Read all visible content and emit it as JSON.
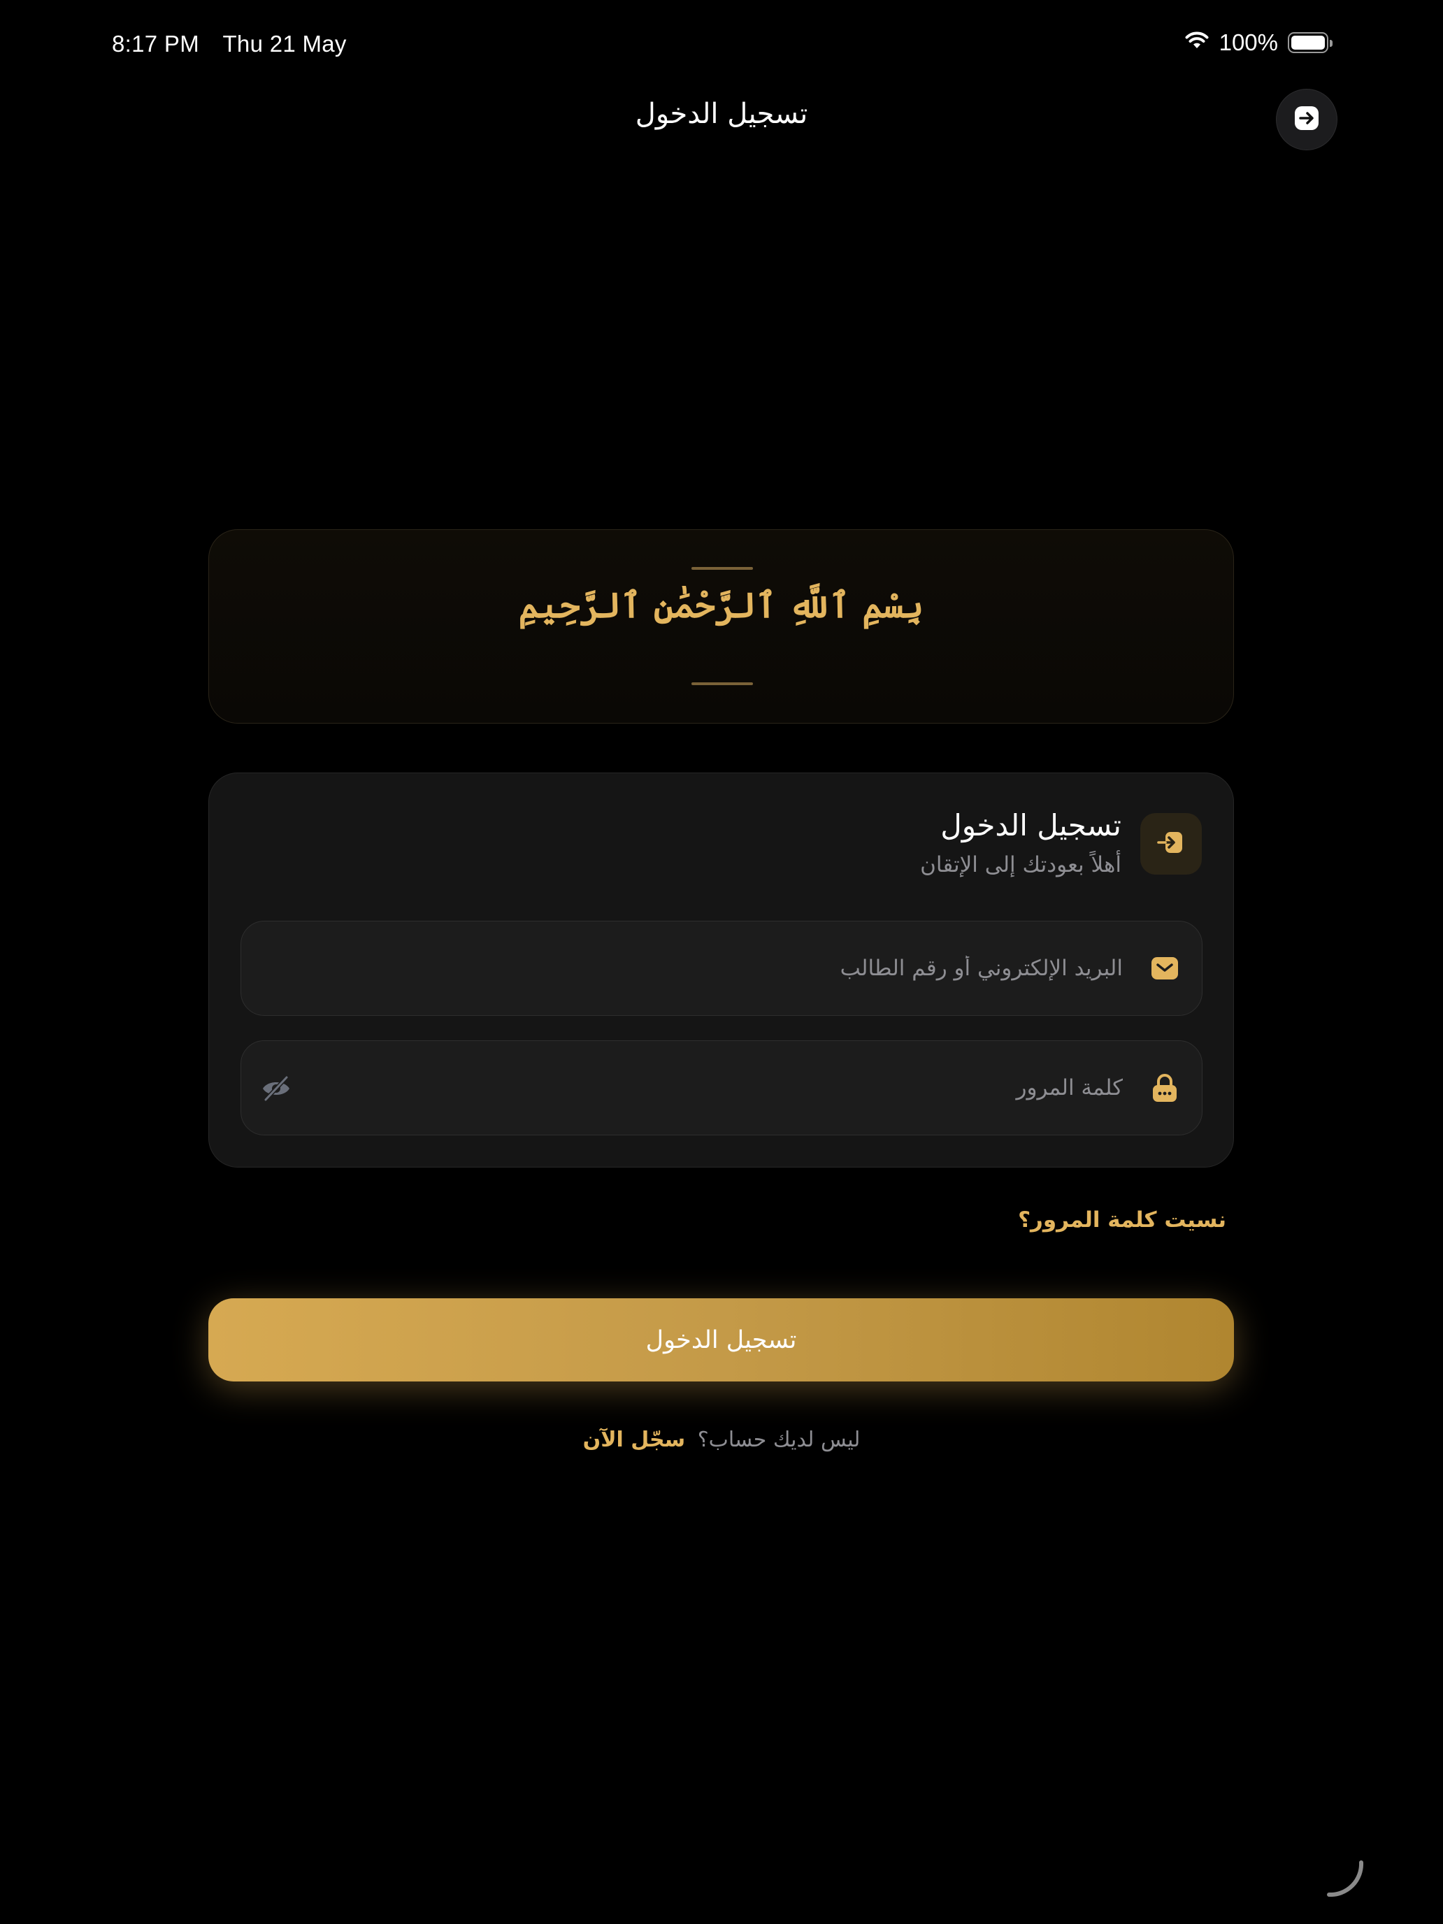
{
  "status_bar": {
    "time": "8:17 PM",
    "date": "Thu 21 May",
    "battery_percent": "100%",
    "battery_level": 1.0,
    "icons": [
      "wifi-icon",
      "battery-icon"
    ]
  },
  "nav": {
    "title": "تسجيل الدخول",
    "exit_icon": "arrow-right-circle-icon"
  },
  "bismillah": {
    "text": "بِسْمِ ٱللَّهِ ٱلرَّحْمَٰنِ ٱلرَّحِيمِ"
  },
  "login_card": {
    "title": "تسجيل الدخول",
    "subtitle": "أهلاً بعودتك إلى الإتقان",
    "icon": "login-arrow-icon",
    "email_field": {
      "value": "",
      "placeholder": "البريد الإلكتروني أو رقم الطالب",
      "icon": "mail-icon"
    },
    "password_field": {
      "value": "",
      "placeholder": "كلمة المرور",
      "icon": "lock-icon",
      "toggle_icon": "eye-slash-icon"
    }
  },
  "forgot_password": "نسيت كلمة المرور؟",
  "login_button": "تسجيل الدخول",
  "signup": {
    "question": "ليس لديك حساب؟",
    "link": "سجّل الآن"
  },
  "colors": {
    "background": "#000000",
    "accent_gold": "#e3b55e",
    "button_gradient_start": "#d6a952",
    "button_gradient_end": "#b08630",
    "card_bg": "#151515",
    "muted_text": "#8e8e93"
  }
}
